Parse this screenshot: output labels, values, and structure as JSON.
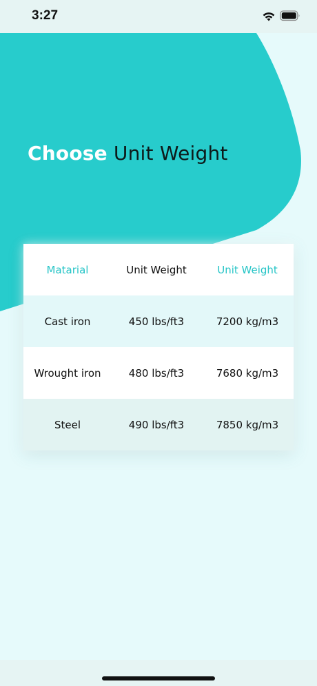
{
  "status_bar": {
    "time": "3:27"
  },
  "colors": {
    "accent": "#27c5c7",
    "blob": "#27cccc",
    "background": "#e6fafb"
  },
  "title": {
    "part1": "Choose",
    "part2": "Unit Weight"
  },
  "table": {
    "headers": [
      "Matarial",
      "Unit Weight",
      "Unit Weight"
    ],
    "rows": [
      [
        "Cast iron",
        "450 lbs/ft3",
        "7200 kg/m3"
      ],
      [
        "Wrought iron",
        "480 lbs/ft3",
        "7680 kg/m3"
      ],
      [
        "Steel",
        "490 lbs/ft3",
        "7850 kg/m3"
      ]
    ]
  }
}
